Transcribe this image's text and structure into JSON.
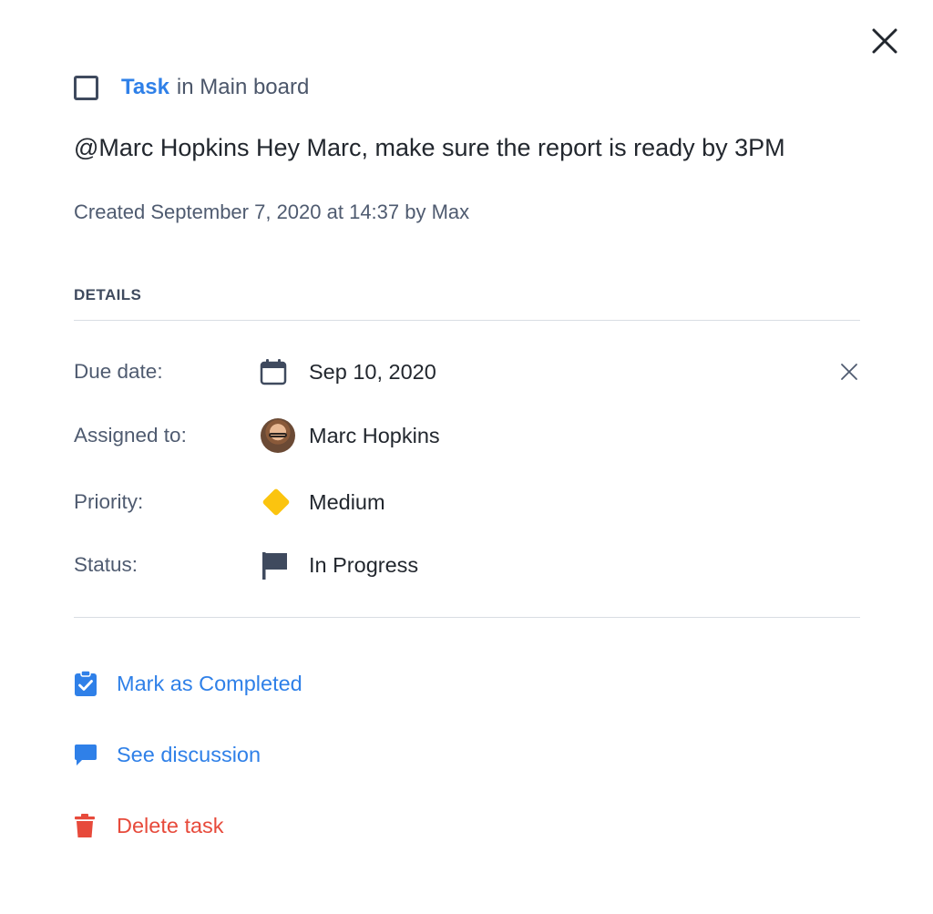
{
  "header": {
    "task_link": "Task",
    "board_text": "in Main board"
  },
  "task": {
    "title": "@Marc Hopkins Hey Marc, make sure the report is ready by 3PM",
    "created": "Created September 7, 2020 at 14:37 by Max"
  },
  "details": {
    "heading": "DETAILS",
    "due_date": {
      "label": "Due date:",
      "value": "Sep 10, 2020",
      "icon": "calendar-icon"
    },
    "assigned": {
      "label": "Assigned to:",
      "value": "Marc Hopkins",
      "icon": "avatar"
    },
    "priority": {
      "label": "Priority:",
      "value": "Medium",
      "icon": "diamond-icon",
      "color": "#fbc40f"
    },
    "status": {
      "label": "Status:",
      "value": "In Progress",
      "icon": "flag-icon"
    }
  },
  "actions": {
    "complete": {
      "label": "Mark as Completed",
      "icon": "clipboard-check-icon"
    },
    "discussion": {
      "label": "See discussion",
      "icon": "chat-bubble-icon"
    },
    "delete": {
      "label": "Delete task",
      "icon": "trash-icon"
    }
  },
  "colors": {
    "accent": "#2f80e8",
    "danger": "#e74a3b",
    "priority_medium": "#fbc40f"
  }
}
